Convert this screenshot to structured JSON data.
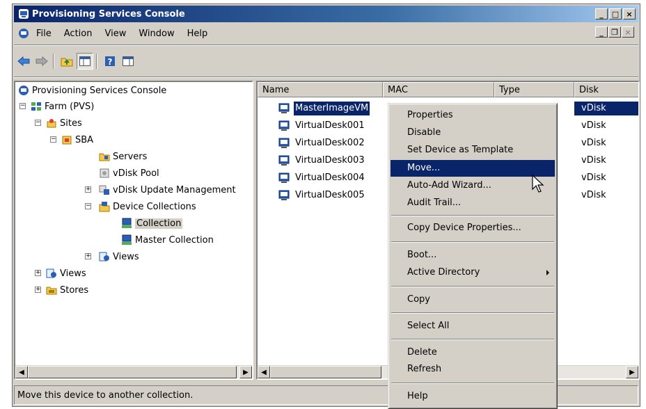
{
  "window": {
    "title": "Provisioning Services Console"
  },
  "menu": [
    "File",
    "Action",
    "View",
    "Window",
    "Help"
  ],
  "toolbar": {
    "icons": [
      "back-arrow-icon",
      "forward-arrow-icon",
      "up-folder-icon",
      "show-tree-icon",
      "help-icon",
      "action-pane-icon"
    ]
  },
  "tree": {
    "root": "Provisioning Services Console",
    "farm": "Farm (PVS)",
    "sites": "Sites",
    "sba": "SBA",
    "servers": "Servers",
    "vdisk_pool": "vDisk Pool",
    "vdisk_update": "vDisk Update Management",
    "device_collections": "Device Collections",
    "collection": "Collection",
    "master_collection": "Master Collection",
    "views_inner": "Views",
    "views": "Views",
    "stores": "Stores"
  },
  "list": {
    "columns": [
      "Name",
      "MAC",
      "Type",
      "Disk"
    ],
    "rows": [
      {
        "name": "MasterImageVM",
        "disk": "vDisk"
      },
      {
        "name": "VirtualDesk001",
        "disk": "vDisk"
      },
      {
        "name": "VirtualDesk002",
        "disk": "vDisk"
      },
      {
        "name": "VirtualDesk003",
        "disk": "vDisk"
      },
      {
        "name": "VirtualDesk004",
        "disk": "vDisk"
      },
      {
        "name": "VirtualDesk005",
        "disk": "vDisk"
      }
    ]
  },
  "context_menu": {
    "properties": "Properties",
    "disable": "Disable",
    "set_template": "Set Device as Template",
    "move": "Move...",
    "auto_add": "Auto-Add Wizard...",
    "audit_trail": "Audit Trail...",
    "copy_props": "Copy Device Properties...",
    "boot": "Boot...",
    "active_directory": "Active Directory",
    "copy": "Copy",
    "select_all": "Select All",
    "delete": "Delete",
    "refresh": "Refresh",
    "help": "Help"
  },
  "status": "Move this device to another collection.",
  "colors": {
    "selection": "#0a246a",
    "chrome": "#d4d0c8",
    "title_gradient_start": "#0a246a"
  }
}
